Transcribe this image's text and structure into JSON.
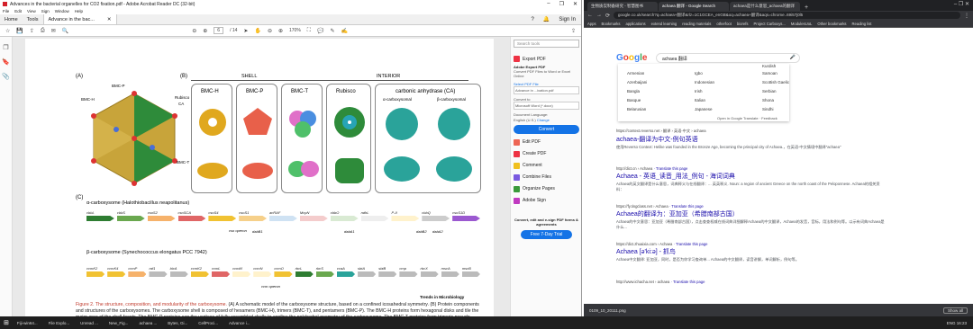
{
  "acrobat": {
    "title": "Advances in the bacterial organelles for CO2 fixation.pdf - Adobe Acrobat Reader DC (32-bit)",
    "menu": [
      "File",
      "Edit",
      "View",
      "Sign",
      "Window",
      "Help"
    ],
    "tabs": {
      "home": "Home",
      "tools": "Tools",
      "doc": "Advance in the bac..."
    },
    "signin": "Sign In",
    "page_num": "6",
    "page_total": "/ 14",
    "zoom": "170%",
    "right_panel": {
      "search": "Search tools",
      "export_pdf": "Export PDF",
      "adobe_export": "Adobe Export PDF",
      "convert_desc": "Convert PDF Files to Word or Excel Online",
      "select_file": "Select PDF File",
      "file": "Advance in ...ixation.pdf",
      "convert_to": "Convert to",
      "word": "Microsoft Word (*.docx)",
      "doc_lang": "Document Language:",
      "lang": "English (U.S.)",
      "change": "Change",
      "convert_btn": "Convert",
      "tools": [
        "Edit PDF",
        "Create PDF",
        "Comment",
        "Combine Files",
        "Organize Pages",
        "Adobe Sign"
      ],
      "promo": "Convert, edit and e-sign PDF forms & agreements",
      "trial_btn": "Free 7-Day Trial"
    },
    "figure": {
      "label_a": "(A)",
      "label_b": "(B)",
      "label_c": "(C)",
      "shell": "SHELL",
      "interior": "INTERIOR",
      "bmc_h": "BMC-H",
      "bmc_p": "BMC-P",
      "bmc_t": "BMC-T",
      "rubisco": "Rubisco",
      "ca": "carbonic anhydrase (CA)",
      "alpha": "α-carboxysomal",
      "beta": "β-carboxysomal",
      "lab_bmcp": "BMC-P",
      "lab_bmch": "BMC-H",
      "lab_rub": "Rubisco",
      "lab_ca": "CA",
      "lab_bmct": "BMC-T",
      "alpha_title": "α-carboxysome (Halothiobacillus neapolitanus)",
      "beta_title": "β-carboxysome (Synechococcus elongatus PCC 7942)",
      "alpha_genes": [
        "cbbL",
        "cbbS",
        "csoS2",
        "csoSCA",
        "csoS4",
        "csoS1",
        "acRAF",
        "McpN",
        "cbbO",
        "ndhL",
        "P-II",
        "cbbQ",
        "csoS1D"
      ],
      "alpha_sub": [
        "cso operon",
        "dabB1",
        "dabA1",
        "dabB2",
        "dabA2"
      ],
      "alpha_letters": [
        "A",
        "B",
        "C",
        "D"
      ],
      "beta_genes": [
        "ccmK2",
        "ccmK4",
        "ccmP",
        "raf1",
        "bicA",
        "ccmK2",
        "ccmL",
        "ccmM",
        "ccmN",
        "ccmO",
        "rbcL",
        "rbcS",
        "ccaA",
        "sbtA",
        "sbtB",
        "cmp",
        "rbcX",
        "mscA",
        "mscB"
      ],
      "beta_sub": "ccm operon",
      "journal": "Trends in Microbiology",
      "caption_head": "Figure 2. The structure, composition, and modularity of the carboxysome.",
      "caption": "(A) A schematic model of the carboxysome structure, based on a confined icosahedral symmetry. (B) Protein components and structures of the carboxysomes. The carboxysome shell is composed of hexamers (BMC-H), trimers (BMC-T), and pentamers (BMC-P). The BMC-H proteins form hexagonal disks and tile the major area of the shell facets. The BMC-P proteins cap the vertices of fully assembled shells to confine the polyhedral geometry of the carboxysome. The BMC-T proteins form trimeric pseudo-hexamers, appearing as hexamers, which make up a smaller"
    }
  },
  "chrome": {
    "tabs": [
      "生物质炭制备研究 - 智慧图书",
      "achaea 翻译 - Google Search",
      "achaea是什么意思_achaea的翻译"
    ],
    "url": "google.co.uk/search?q=achaea+翻译&rlz=1C1GCEA_enGB&oq=achaea+翻译&aqs=chrome..69i57j0l5",
    "bookmarks": [
      "Apps",
      "Bookmarks",
      "applications",
      "extend learning",
      "reading materials",
      "otherfoot",
      "biorefs",
      "Project Carboxys...",
      "ModulesUoL",
      "Other bookmarks",
      "Reading list"
    ],
    "query": "achaea 翻译",
    "languages": [
      [
        "Armenian",
        "Igbo",
        "Samoan"
      ],
      [
        "Azerbaijani",
        "Indonesian",
        "Scottish Gaelic"
      ],
      [
        "Bangla",
        "Irish",
        "Serbian"
      ],
      [
        "Basque",
        "Italian",
        "Shona"
      ],
      [
        "Belarusian",
        "Japanese",
        "Sindhi"
      ]
    ],
    "lang_top": "Kurdish",
    "open_translate": "Open in Google Translate",
    "feedback": "Feedback",
    "results": [
      {
        "url": "https://context.reverso.net › 翻译 › 英语-中文 › achaea",
        "title": "achaea-翻译为中文-例句英语",
        "snip": "使用Reverso Context: Helike was founded in the Bronze Age, becoming the principal city of Achaea.，在英语-中文情境中翻译\"achaea\""
      },
      {
        "url": "http://dict.cn › Achaea",
        "link": "Translate this page",
        "title": "Achaea - 英语_读音_用法_例句 - 海词词典",
        "snip": "Achaea的英文翻译是什么意思，词典释义与在线翻译：... 英英释义. Noun: a region of ancient Greece on the north coast of the Peloponnese. Achaea的相关资料："
      },
      {
        "url": "https://fy.tingclass.net › Achaea",
        "link": "Translate this page",
        "title": "Achaea的翻译为：亚加亚（希腊南部古国）",
        "snip": "Achaea的中文意思：亚加亚（希腊南部古国），点击查查权威在线词典详细解释Achaea的中文翻译，Achaea的发音，音标，用法和例句等。以示有词典Achaea是什么..."
      },
      {
        "url": "https://dict.zhuaixia.com › Achaea",
        "link": "Translate this page",
        "title": "Achaea [ə'ki:ə] - 抓鸟",
        "snip": "Achaea中文翻译: 亚加亚，同时，是否为你学习查询单... Achaea的中文翻译，读音讲解，单词解析，例句等。"
      },
      {
        "url": "http://www.ichacha.net › achaea",
        "link": "Translate this page",
        "title": "",
        "snip": ""
      }
    ],
    "download_file": "0109_10_20111.png",
    "show_all": "Show all"
  },
  "taskbar": {
    "items": [
      "Fiji-win64...",
      "File Explo...",
      "Unread ...",
      "New_Fig...",
      "achaea ...",
      "Bytes, Gi...",
      "CellProci...",
      "Advance i..."
    ],
    "time": "16:23",
    "lang": "ENG"
  },
  "colors": {
    "acrobat_blue": "#1473e6",
    "chrome_dark": "#202124",
    "link": "#1a0dab",
    "caption_red": "#c0392b"
  }
}
